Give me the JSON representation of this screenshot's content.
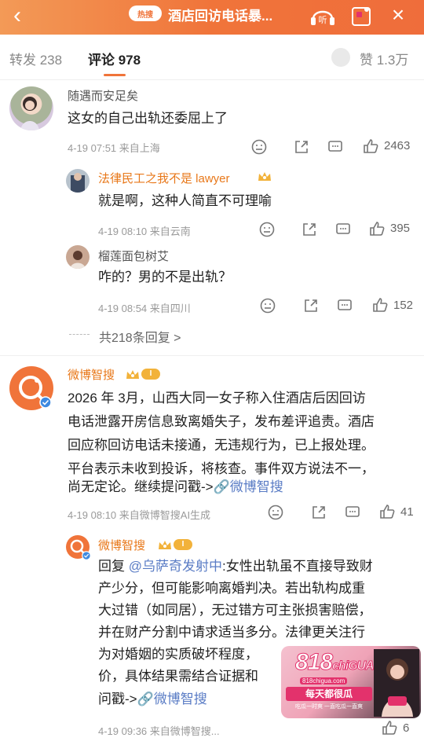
{
  "topbar": {
    "topic_pill": "热搜",
    "title": "酒店回访电话暴...",
    "listen_label": "听"
  },
  "tabs": {
    "repost": "转发 238",
    "comment": "评论 978",
    "like": "赞 1.3万"
  },
  "comments": [
    {
      "name": "随遇而安足矣",
      "text": "这女的自己出轨还委屈上了",
      "meta": "4-19 07:51 来自上海",
      "likes": "2463",
      "replies": [
        {
          "name": "法律民工之我不是 lawyer",
          "text": "就是啊，这种人简直不可理喻",
          "meta": "4-19 08:10 来自云南",
          "likes": "395"
        },
        {
          "name": "榴莲面包树艾",
          "text": "咋的？男的不是出轨？",
          "meta": "4-19 08:54 来自四川",
          "likes": "152"
        }
      ],
      "more_replies": "共218条回复 >"
    },
    {
      "name": "微博智搜",
      "level": "I",
      "text_lines": [
        "2026 年 3月，山西大同一女子称入住酒店后因回访",
        "电话泄露开房信息致离婚失子，发布差评追责。酒店",
        "回应称回访电话未接通，无违规行为，已上报处理。",
        "平台表示未收到投诉，将核查。事件双方说法不一，"
      ],
      "last_line_prefix": "尚无定论。继续提问戳->",
      "last_line_link": "🔗微博智搜",
      "meta": "4-19 08:10 来自微博智搜AI生成",
      "likes": "41",
      "reply": {
        "name": "微博智搜",
        "level": "I",
        "reply_prefix": "回复 ",
        "reply_target": "@乌萨奇发射中",
        "text_first": ":女性出轨虽不直接导致财",
        "text_lines": [
          "产少分，但可能影响离婚判决。若出轨构成重",
          "大过错（如同居），无过错方可主张损害赔偿，",
          "并在财产分割中请求适当多分。法律更关注行",
          "为对婚姻的实质破坏程度，",
          "价，具体结果需结合证据和"
        ],
        "last_line_prefix": "问戳->",
        "last_line_link": "🔗微博智搜",
        "meta": "4-19 09:36 来自微博智搜...",
        "likes": "6"
      }
    }
  ],
  "watermark": {
    "logo_main": "818",
    "logo_sub": "chiGUA",
    "url": "818chigua.com",
    "tagline": "每天都很瓜",
    "sub": "吃瓜一时爽 一直吃瓜一直爽"
  },
  "colors": {
    "topbar": "#f0743a",
    "accent_orange": "#e8781a",
    "link_blue": "#5a7cc5",
    "badge_gold": "#f2b23a"
  },
  "icons": [
    "back-icon",
    "listen-icon",
    "gift-icon",
    "close-icon",
    "emoji-icon",
    "share-icon",
    "comment-icon",
    "like-icon",
    "crown-icon",
    "verified-icon"
  ]
}
